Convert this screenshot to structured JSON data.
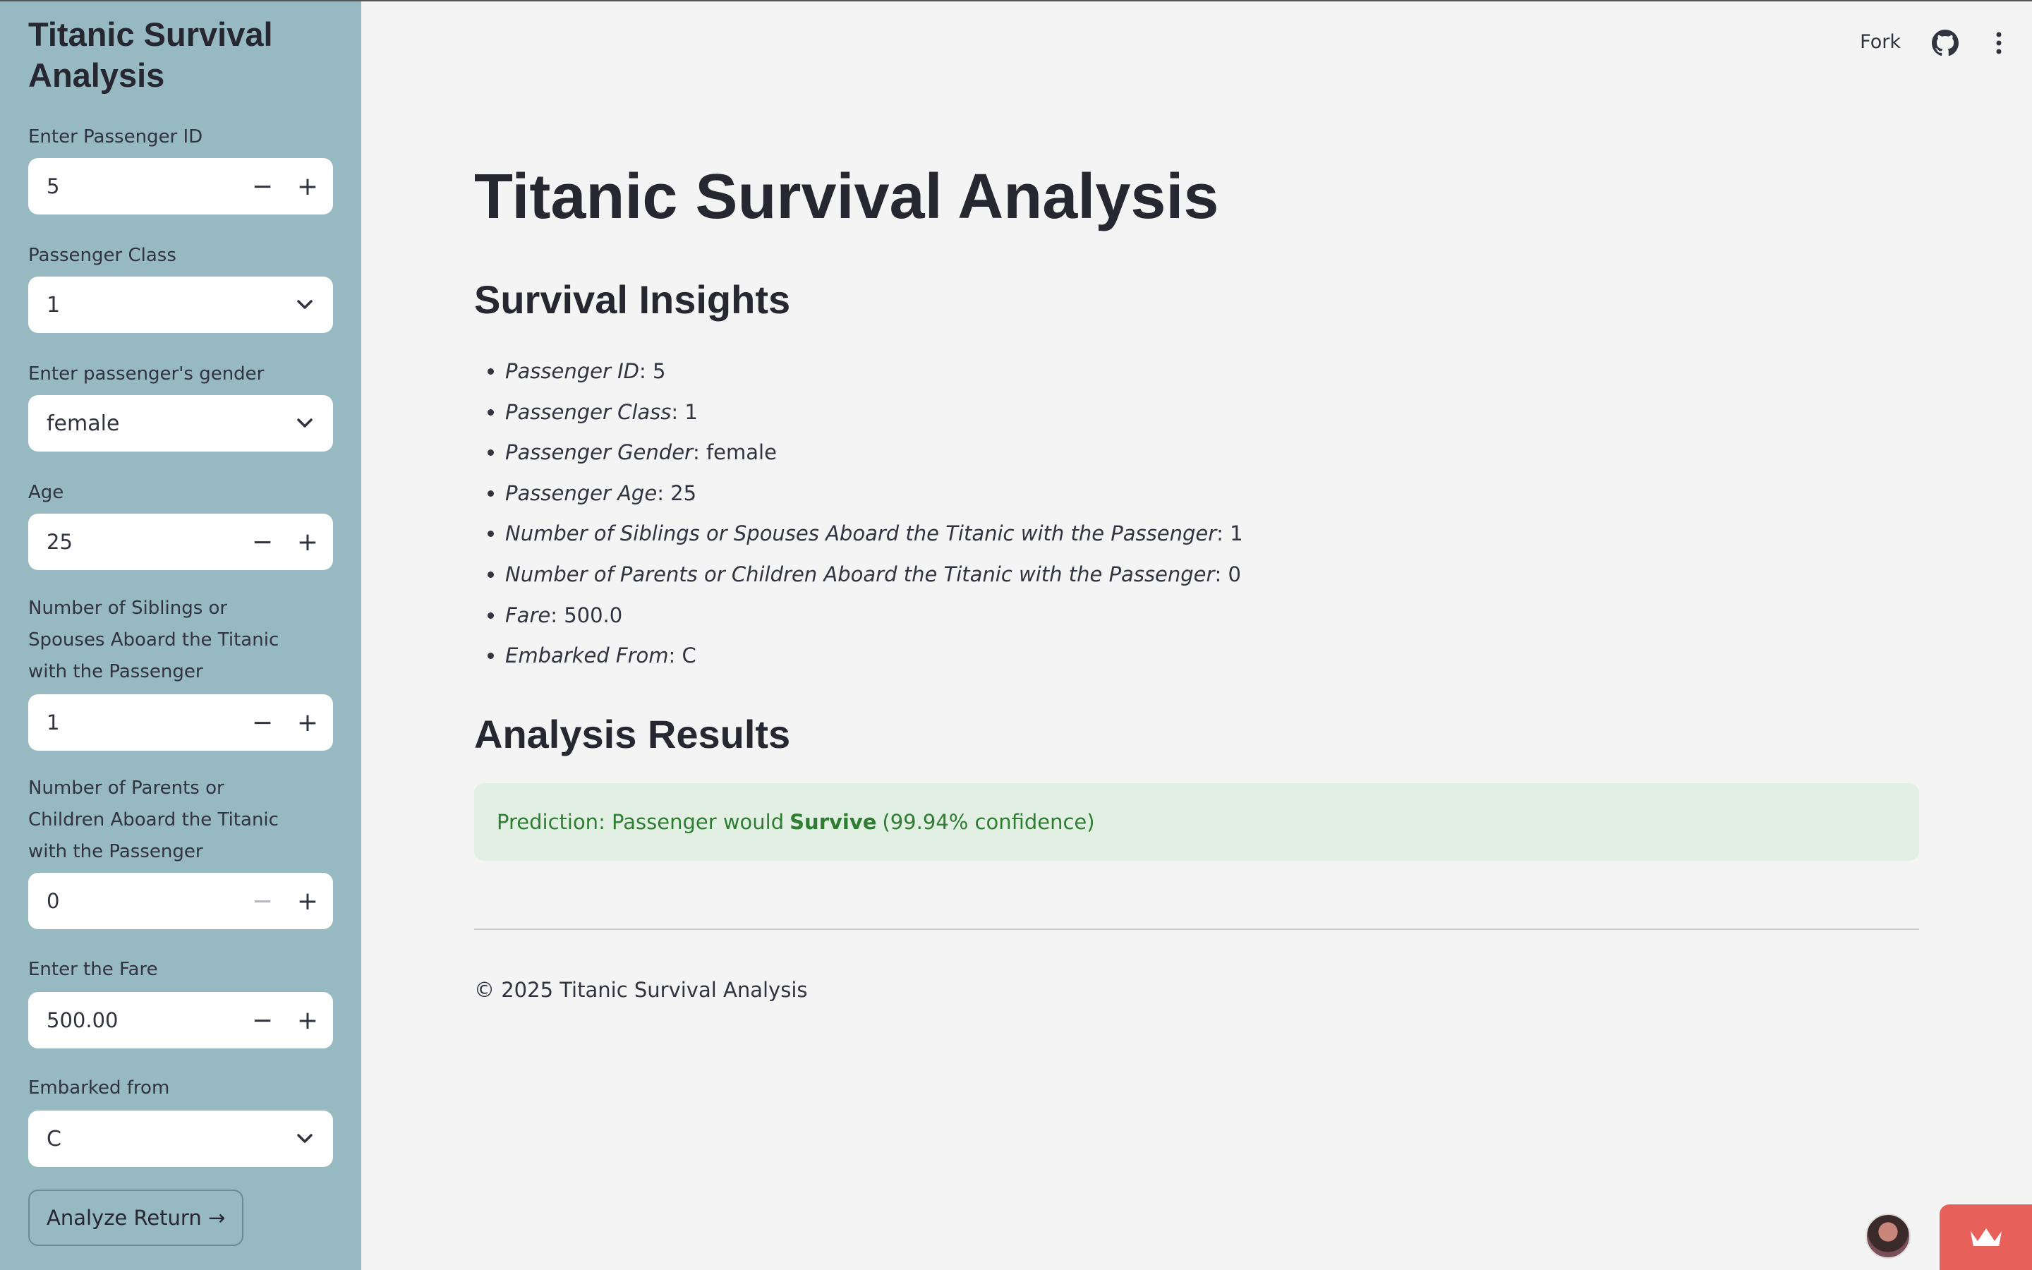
{
  "sidebar": {
    "title": "Titanic Survival Analysis",
    "passenger_id": {
      "label": "Enter Passenger ID",
      "value": "5"
    },
    "passenger_class": {
      "label": "Passenger Class",
      "value": "1"
    },
    "gender": {
      "label": "Enter passenger's gender",
      "value": "female"
    },
    "age": {
      "label": "Age",
      "value": "25"
    },
    "sibsp": {
      "label": "Number of Siblings or Spouses Aboard the Titanic with the Passenger",
      "value": "1"
    },
    "parch": {
      "label": "Number of Parents or Children Aboard the Titanic with the Passenger",
      "value": "0"
    },
    "fare": {
      "label": "Enter the Fare",
      "value": "500.00"
    },
    "embarked": {
      "label": "Embarked from",
      "value": "C"
    },
    "analyze_button": "Analyze Return →"
  },
  "toolbar": {
    "fork_label": "Fork",
    "icons": [
      "github-icon",
      "kebab-menu-icon"
    ]
  },
  "main": {
    "title": "Titanic Survival Analysis",
    "insights_heading": "Survival Insights",
    "insights": [
      {
        "key": "Passenger ID",
        "value": ": 5"
      },
      {
        "key": "Passenger Class",
        "value": ": 1"
      },
      {
        "key": "Passenger Gender",
        "value": ": female"
      },
      {
        "key": "Passenger Age",
        "value": ": 25"
      },
      {
        "key": "Number of Siblings or Spouses Aboard the Titanic with the Passenger",
        "value": ": 1"
      },
      {
        "key": "Number of Parents or Children Aboard the Titanic with the Passenger",
        "value": ": 0"
      },
      {
        "key": "Fare",
        "value": ": 500.0"
      },
      {
        "key": "Embarked From",
        "value": ": C"
      }
    ],
    "results_heading": "Analysis Results",
    "prediction": {
      "prefix": "Prediction: Passenger would",
      "outcome": "Survive",
      "suffix": "(99.94% confidence)"
    },
    "footer": "© 2025 Titanic Survival Analysis"
  },
  "colors": {
    "sidebar": "#97b9c2",
    "success_bg": "#e2efe3",
    "success_text": "#2e7d32",
    "brand": "#e8605a"
  }
}
